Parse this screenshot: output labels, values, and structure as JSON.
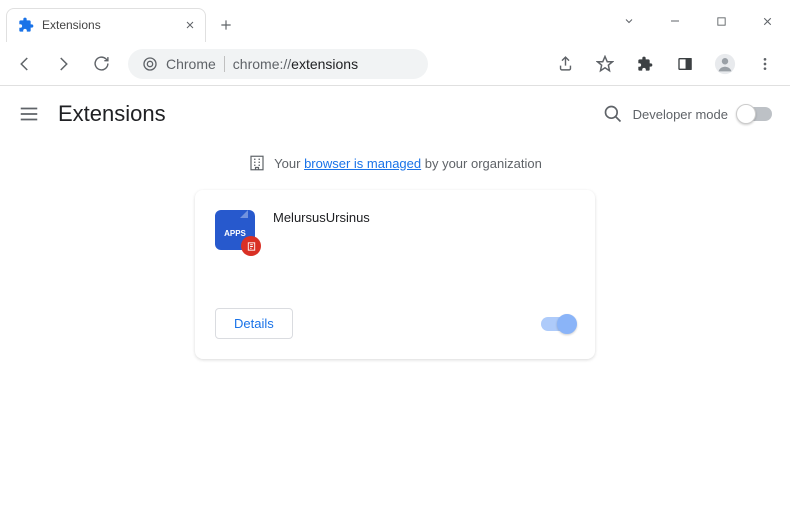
{
  "window": {
    "tab_title": "Extensions"
  },
  "omnibox": {
    "scheme_label": "Chrome",
    "url_path": "chrome://",
    "url_bold": "extensions"
  },
  "header": {
    "title": "Extensions",
    "developer_mode_label": "Developer mode",
    "developer_mode_on": false
  },
  "managed_banner": {
    "prefix": "Your ",
    "link_text": "browser is managed",
    "suffix": " by your organization"
  },
  "extension": {
    "name": "MelursusUrsinus",
    "icon_label": "APPS",
    "details_label": "Details",
    "enabled": true
  }
}
